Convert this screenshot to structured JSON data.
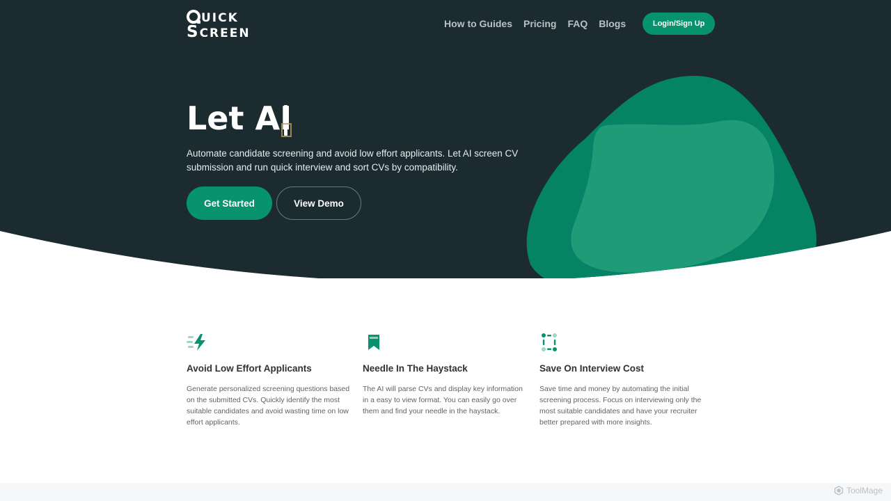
{
  "logo": {
    "line1_first": "Q",
    "line1_rest": "UICK",
    "line2_first": "S",
    "line2_rest": "CREEN"
  },
  "nav": {
    "links": [
      "How to Guides",
      "Pricing",
      "FAQ",
      "Blogs"
    ],
    "login_label": "Login/Sign Up"
  },
  "hero": {
    "headline": "Let AI",
    "subtitle": "Automate candidate screening and avoid low effort applicants. Let AI screen CV submission and run quick interview and sort CVs by compatibility.",
    "primary_button": "Get Started",
    "secondary_button": "View Demo"
  },
  "features": [
    {
      "icon": "lightning-icon",
      "title": "Avoid Low Effort Applicants",
      "body": "Generate personalized screening questions based on the submitted CVs. Quickly identify the most suitable candidates and avoid wasting time on low effort applicants."
    },
    {
      "icon": "bookmark-icon",
      "title": "Needle In The Haystack",
      "body": "The AI will parse CVs and display key information in a easy to view format. You can easily go over them and find your needle in the haystack."
    },
    {
      "icon": "dotted-square-icon",
      "title": "Save On Interview Cost",
      "body": "Save time and money by automating the initial screening process. Focus on interviewing only the most suitable candidates and have your recruiter better prepared with more insights."
    }
  ],
  "watermark": "ToolMage",
  "colors": {
    "hero_background": "#1b2b30",
    "accent": "#07936d",
    "blob": "#048465",
    "blob_inner": "#2aa37f"
  }
}
